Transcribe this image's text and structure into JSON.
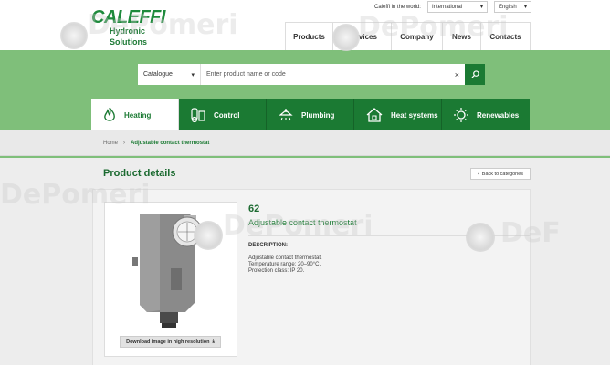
{
  "header": {
    "logo_main": "CALEFFI",
    "logo_sub": "Hydronic Solutions",
    "top_link": "Caleffi in the world:",
    "intl_select": "International",
    "lang_select": "English",
    "nav": [
      {
        "label": "Products",
        "w": 52
      },
      {
        "label": "Services",
        "w": 64
      },
      {
        "label": "Company",
        "w": 56
      },
      {
        "label": "News",
        "w": 42
      },
      {
        "label": "Contacts",
        "w": 55
      }
    ]
  },
  "search": {
    "catalogue": "Catalogue",
    "placeholder": "Enter product name or code",
    "clear": "×"
  },
  "categories": [
    {
      "label": "Heating",
      "icon": "flame-icon"
    },
    {
      "label": "Control",
      "icon": "thermostat-icon"
    },
    {
      "label": "Plumbing",
      "icon": "shower-icon"
    },
    {
      "label": "Heat systems",
      "icon": "house-heat-icon"
    },
    {
      "label": "Renewables",
      "icon": "sun-icon"
    }
  ],
  "breadcrumb": {
    "home": "Home",
    "sep": "›",
    "current": "Adjustable contact thermostat"
  },
  "page": {
    "title": "Product details",
    "back": "Back to categories"
  },
  "product": {
    "code": "62",
    "name": "Adjustable contact thermostat",
    "download": "Download image in high resolution",
    "desc_title": "DESCRIPTION:",
    "desc_lines": [
      "Adjustable contact thermostat.",
      "Temperature range: 20–90°C.",
      "Protection class: IP 20."
    ]
  },
  "watermark": {
    "text": "DePomeri",
    "text2": "DeF"
  },
  "colors": {
    "brand_green": "#1b7a33",
    "band_green": "#7fbf7a"
  }
}
